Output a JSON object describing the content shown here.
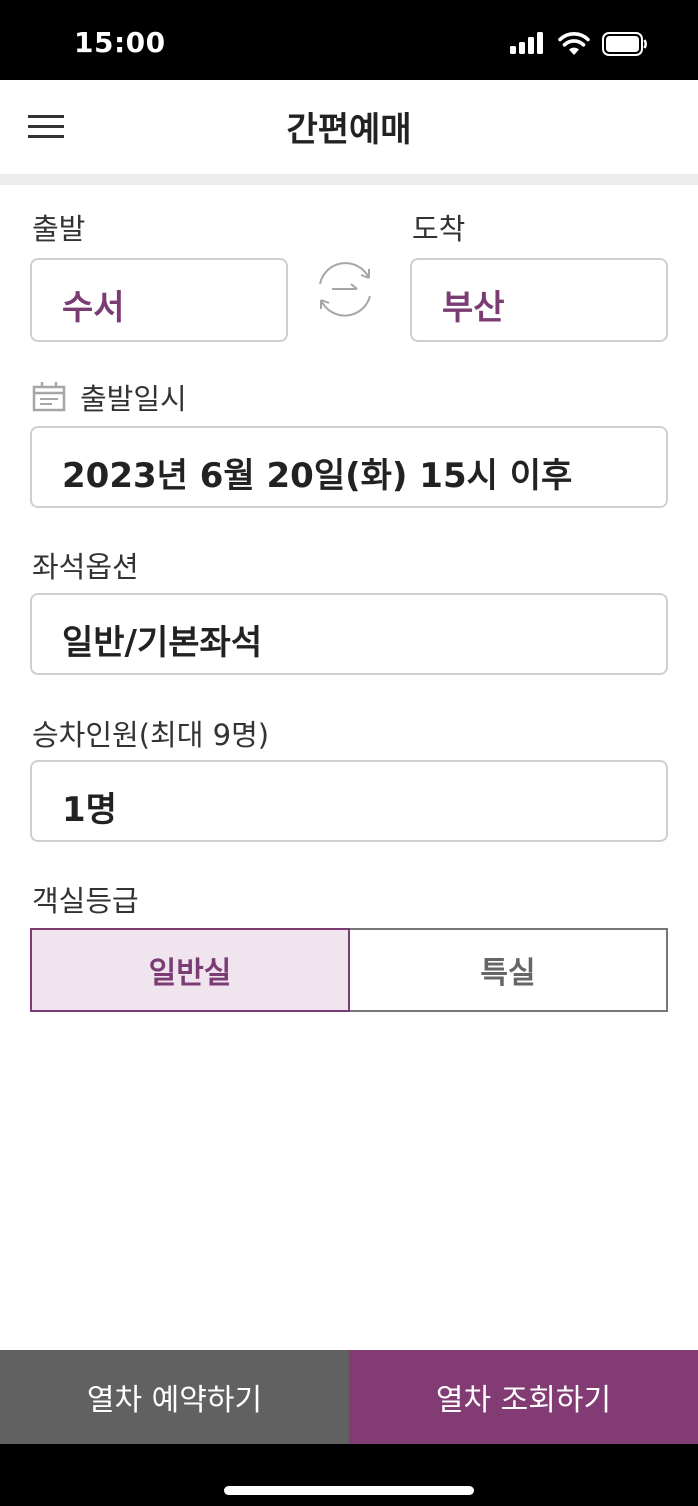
{
  "status_bar": {
    "time": "15:00"
  },
  "header": {
    "title": "간편예매"
  },
  "route": {
    "departure_label": "출발",
    "arrival_label": "도착",
    "departure_value": "수서",
    "arrival_value": "부산"
  },
  "date": {
    "label": "출발일시",
    "value": "2023년 6월 20일(화) 15시 이후"
  },
  "seat": {
    "label": "좌석옵션",
    "value": "일반/기본좌석"
  },
  "passengers": {
    "label": "승차인원(최대 9명)",
    "value": "1명"
  },
  "cabin": {
    "label": "객실등급",
    "options": [
      "일반실",
      "특실"
    ],
    "selected": "일반실"
  },
  "actions": {
    "reserve": "열차 예약하기",
    "search": "열차 조회하기"
  },
  "colors": {
    "accent": "#833b73",
    "station_text": "#7b3b73",
    "reserve_button": "#616161",
    "selected_segment_bg": "#f0e5ee"
  }
}
